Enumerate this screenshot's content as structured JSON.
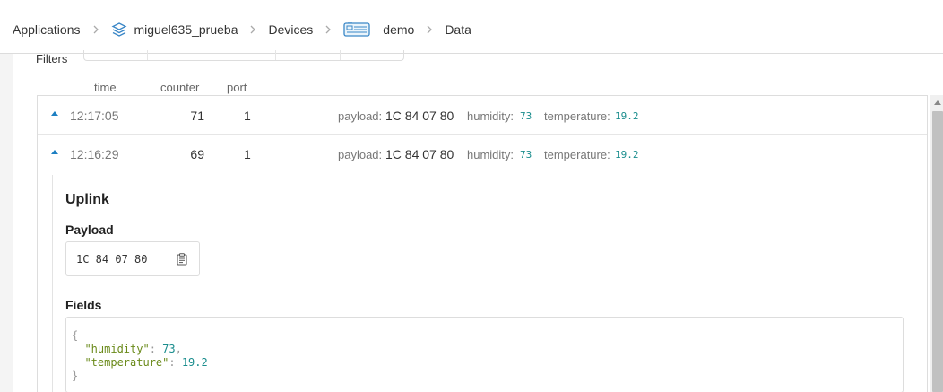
{
  "breadcrumb": {
    "items": [
      {
        "label": "Applications"
      },
      {
        "label": "miguel635_prueba"
      },
      {
        "label": "Devices"
      },
      {
        "label": "demo"
      },
      {
        "label": "Data"
      }
    ]
  },
  "filters": {
    "label": "Filters"
  },
  "columns": {
    "time": "time",
    "counter": "counter",
    "port": "port"
  },
  "rows": [
    {
      "time": "12:17:05",
      "counter": "71",
      "port": "1",
      "payload_label": "payload:",
      "payload": "1C 84 07 80",
      "humidity_label": "humidity:",
      "humidity": "73",
      "temperature_label": "temperature:",
      "temperature": "19.2"
    },
    {
      "time": "12:16:29",
      "counter": "69",
      "port": "1",
      "payload_label": "payload:",
      "payload": "1C 84 07 80",
      "humidity_label": "humidity:",
      "humidity": "73",
      "temperature_label": "temperature:",
      "temperature": "19.2"
    }
  ],
  "detail": {
    "uplink_title": "Uplink",
    "payload_title": "Payload",
    "payload_hex": "1C 84 07 80",
    "fields_title": "Fields",
    "fields_json": {
      "open": "{",
      "humidity_key": "\"humidity\"",
      "humidity_value": "73",
      "temperature_key": "\"temperature\"",
      "temperature_value": "19.2",
      "close": "}"
    }
  },
  "icons": {
    "app": "cube-stack-icon",
    "device": "device-board-icon",
    "copy": "clipboard-copy-icon",
    "expand": "caret-up-icon"
  },
  "colors": {
    "accent": "#1d7fc2",
    "numeric": "#1a8d8d",
    "json_key": "#6a8a1a"
  }
}
